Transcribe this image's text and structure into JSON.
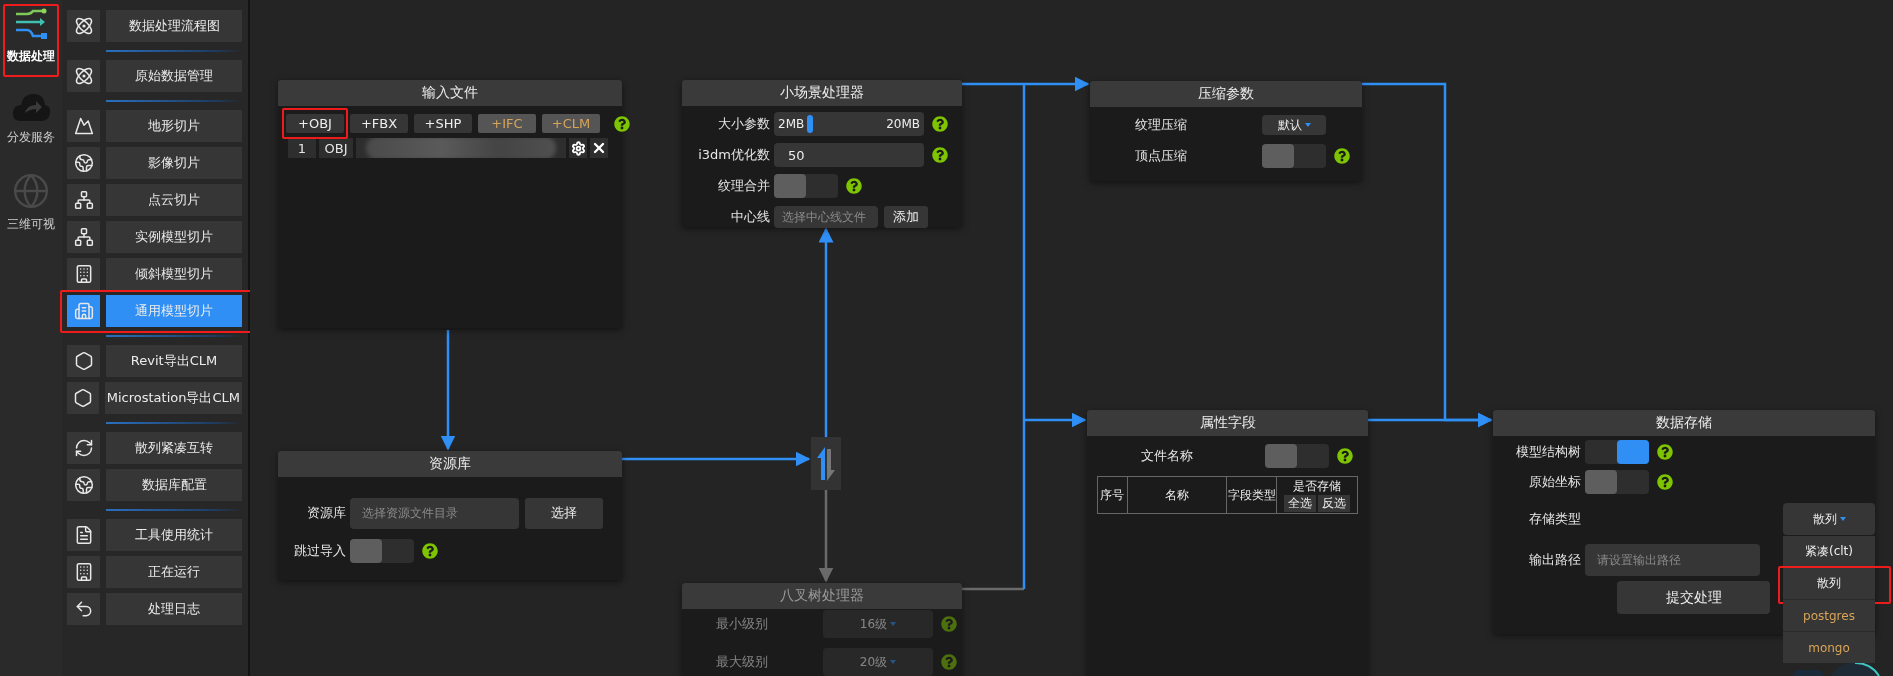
{
  "rail": [
    {
      "label": "数据处理",
      "selected": true,
      "annotated": true
    },
    {
      "label": "分发服务",
      "selected": false,
      "annotated": false
    },
    {
      "label": "三维可视",
      "selected": false,
      "annotated": false
    }
  ],
  "menu_groups": [
    {
      "items": [
        {
          "label": "数据处理流程图",
          "selected": false,
          "annotated": false
        }
      ]
    },
    {
      "items": [
        {
          "label": "原始数据管理",
          "selected": false,
          "annotated": false
        }
      ]
    },
    {
      "items": [
        {
          "label": "地形切片",
          "selected": false,
          "annotated": false
        },
        {
          "label": "影像切片",
          "selected": false,
          "annotated": false
        },
        {
          "label": "点云切片",
          "selected": false,
          "annotated": false
        },
        {
          "label": "实例模型切片",
          "selected": false,
          "annotated": false
        },
        {
          "label": "倾斜模型切片",
          "selected": false,
          "annotated": false
        },
        {
          "label": "通用模型切片",
          "selected": true,
          "annotated": true
        }
      ]
    },
    {
      "items": [
        {
          "label": "Revit导出CLM",
          "selected": false,
          "annotated": false
        },
        {
          "label": "Microstation导出CLM",
          "selected": false,
          "annotated": false
        }
      ]
    },
    {
      "items": [
        {
          "label": "散列紧凑互转",
          "selected": false,
          "annotated": false
        },
        {
          "label": "数据库配置",
          "selected": false,
          "annotated": false
        }
      ]
    },
    {
      "items": [
        {
          "label": "工具使用统计",
          "selected": false,
          "annotated": false
        },
        {
          "label": "正在运行",
          "selected": false,
          "annotated": false
        },
        {
          "label": "处理日志",
          "selected": false,
          "annotated": false
        }
      ]
    }
  ],
  "input_file": {
    "title": "输入文件",
    "help": true,
    "buttons": [
      {
        "label": "+OBJ",
        "disabled": false,
        "annotated": true
      },
      {
        "label": "+FBX",
        "disabled": false,
        "annotated": false
      },
      {
        "label": "+SHP",
        "disabled": false,
        "annotated": false
      },
      {
        "label": "+IFC",
        "disabled": true,
        "annotated": false
      },
      {
        "label": "+CLM",
        "disabled": true,
        "annotated": false
      }
    ],
    "files": [
      {
        "index": "1",
        "type": "OBJ",
        "redacted": true
      }
    ]
  },
  "resource_library": {
    "title": "资源库",
    "rows": [
      {
        "kind": "file",
        "label": "资源库",
        "placeholder": "选择资源文件目录",
        "button": "选择"
      },
      {
        "kind": "toggle",
        "label": "跳过导入",
        "on": false,
        "help": true
      }
    ]
  },
  "small_scene_processor": {
    "title": "小场景处理器",
    "rows": [
      {
        "kind": "slider",
        "label": "大小参数",
        "min_label": "2MB",
        "max_label": "20MB",
        "level": 0.24,
        "help": true
      },
      {
        "kind": "input",
        "label": "i3dm优化数",
        "value": "50",
        "help": true
      },
      {
        "kind": "toggle",
        "label": "纹理合并",
        "on": false,
        "help": true
      },
      {
        "kind": "file",
        "label": "中心线",
        "placeholder": "选择中心线文件",
        "button": "添加"
      }
    ]
  },
  "octree_processor": {
    "title": "八叉树处理器",
    "disabled": true,
    "rows": [
      {
        "kind": "dropdown",
        "label": "最小级别",
        "value": "16级",
        "help": true
      },
      {
        "kind": "dropdown",
        "label": "最大级别",
        "value": "20级",
        "help": true
      }
    ]
  },
  "compression": {
    "title": "压缩参数",
    "rows": [
      {
        "kind": "dropdown",
        "label": "纹理压缩",
        "value": "默认"
      },
      {
        "kind": "toggle",
        "label": "顶点压缩",
        "on": false,
        "help": true
      }
    ]
  },
  "attribute_fields": {
    "title": "属性字段",
    "rows": [
      {
        "kind": "toggle",
        "label": "文件名称",
        "on": false,
        "help": true
      }
    ],
    "table": {
      "columns": [
        "序号",
        "名称",
        "字段类型",
        "是否存储"
      ],
      "column_actions": [
        "全选",
        "反选"
      ]
    }
  },
  "data_storage": {
    "title": "数据存储",
    "rows": [
      {
        "kind": "toggle",
        "label": "模型结构树",
        "on": true,
        "help": true
      },
      {
        "kind": "toggle",
        "label": "原始坐标",
        "on": false,
        "help": true
      },
      {
        "kind": "select",
        "label": "存储类型",
        "value": "散列",
        "open": true,
        "options": [
          {
            "label": "紧凑(clt)",
            "disabled": false,
            "annotated": false
          },
          {
            "label": "散列",
            "disabled": false,
            "annotated": true
          },
          {
            "label": "postgres",
            "disabled": true,
            "annotated": false
          },
          {
            "label": "mongo",
            "disabled": true,
            "annotated": false
          }
        ]
      },
      {
        "kind": "input",
        "label": "输出路径",
        "placeholder": "请设置输出路径"
      }
    ],
    "submit": "提交处理"
  }
}
